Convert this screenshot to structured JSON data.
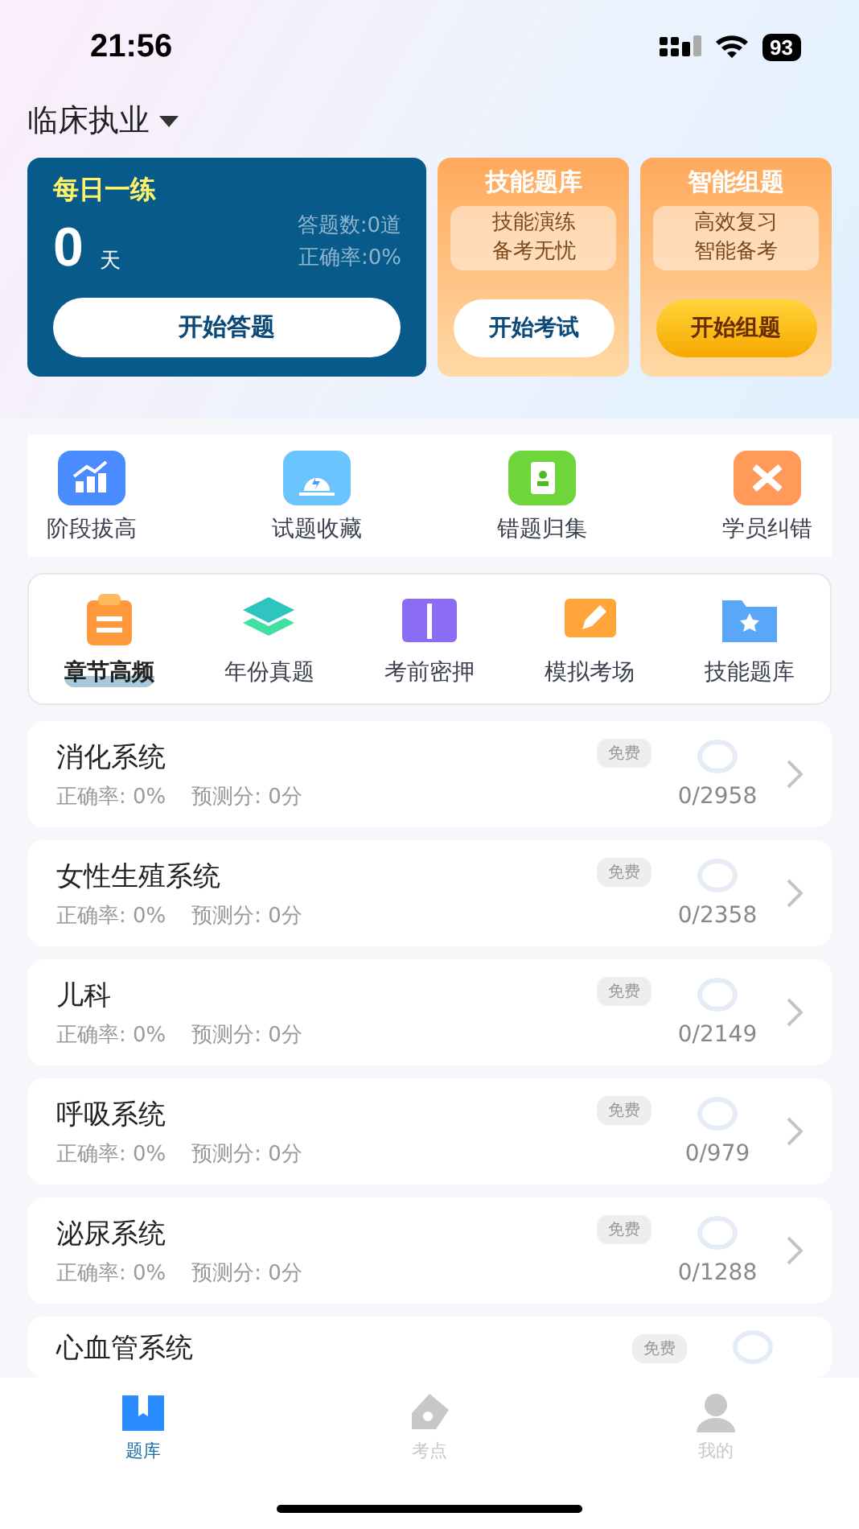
{
  "status_bar": {
    "time": "21:56",
    "battery": "93"
  },
  "header": {
    "title": "临床执业"
  },
  "daily": {
    "title": "每日一练",
    "days": "0",
    "unit": "天",
    "answered": "答题数:0道",
    "accuracy": "正确率:0%",
    "button": "开始答题"
  },
  "promo_cards": [
    {
      "kind": "white",
      "title": "技能题库",
      "line1": "技能演练",
      "line2": "备考无忧",
      "button": "开始考试"
    },
    {
      "kind": "gold",
      "title": "智能组题",
      "line1": "高效复习",
      "line2": "智能备考",
      "button": "开始组题"
    }
  ],
  "quick_links": [
    {
      "kind": "chart",
      "label": "阶段拔高"
    },
    {
      "kind": "alarm",
      "label": "试题收藏"
    },
    {
      "kind": "notebook",
      "label": "错题归集"
    },
    {
      "kind": "tools",
      "label": "学员纠错"
    }
  ],
  "categories": [
    {
      "kind": "clipboard",
      "label": "章节高频",
      "selected": true
    },
    {
      "kind": "layers",
      "label": "年份真题",
      "selected": false
    },
    {
      "kind": "book",
      "label": "考前密押",
      "selected": false
    },
    {
      "kind": "easel",
      "label": "模拟考场",
      "selected": false
    },
    {
      "kind": "folder",
      "label": "技能题库",
      "selected": false
    }
  ],
  "chapters": [
    {
      "title": "消化系统",
      "badge": "免费",
      "accuracy": "正确率: 0%",
      "score": "预测分: 0分",
      "progress": "0/2958"
    },
    {
      "title": "女性生殖系统",
      "badge": "免费",
      "accuracy": "正确率: 0%",
      "score": "预测分: 0分",
      "progress": "0/2358"
    },
    {
      "title": "儿科",
      "badge": "免费",
      "accuracy": "正确率: 0%",
      "score": "预测分: 0分",
      "progress": "0/2149"
    },
    {
      "title": "呼吸系统",
      "badge": "免费",
      "accuracy": "正确率: 0%",
      "score": "预测分: 0分",
      "progress": "0/979"
    },
    {
      "title": "泌尿系统",
      "badge": "免费",
      "accuracy": "正确率: 0%",
      "score": "预测分: 0分",
      "progress": "0/1288"
    },
    {
      "title": "心血管系统",
      "badge": "免费"
    }
  ],
  "tab_bar": [
    {
      "kind": "book",
      "label": "题库",
      "selected": true
    },
    {
      "kind": "pen",
      "label": "考点",
      "selected": false
    },
    {
      "kind": "person",
      "label": "我的",
      "selected": false
    }
  ]
}
